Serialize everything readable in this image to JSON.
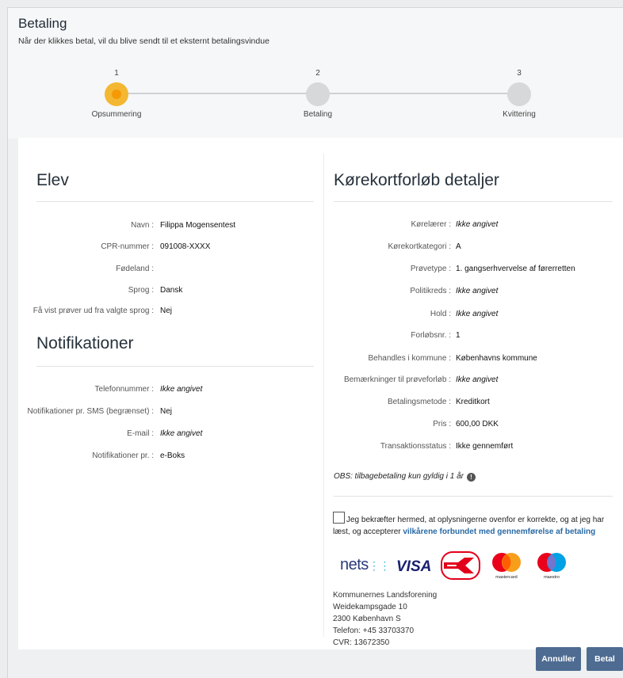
{
  "dialog": {
    "title": "Betaling",
    "subtitle": "Når der klikkes betal, vil du blive sendt til et eksternt betalingsvindue"
  },
  "steps": [
    {
      "number": "1",
      "label": "Opsummering",
      "active": true
    },
    {
      "number": "2",
      "label": "Betaling",
      "active": false
    },
    {
      "number": "3",
      "label": "Kvittering",
      "active": false
    }
  ],
  "elev": {
    "heading": "Elev",
    "fields": [
      {
        "label": "Navn :",
        "value": "Filippa Mogensentest"
      },
      {
        "label": "CPR-nummer :",
        "value": "091008-XXXX"
      },
      {
        "label": "Fødeland :",
        "value": ""
      },
      {
        "label": "Sprog :",
        "value": "Dansk"
      },
      {
        "label": "Få vist prøver ud fra valgte sprog :",
        "value": "Nej"
      }
    ]
  },
  "notifikationer": {
    "heading": "Notifikationer",
    "fields": [
      {
        "label": "Telefonnummer :",
        "value": "Ikke angivet"
      },
      {
        "label": "Notifikationer pr. SMS (begrænset) :",
        "value": "Nej"
      },
      {
        "label": "E-mail :",
        "value": "Ikke angivet"
      },
      {
        "label": "Notifikationer pr. :",
        "value": "e-Boks"
      }
    ]
  },
  "detaljer": {
    "heading": "Kørekortforløb detaljer",
    "fields": [
      {
        "label": "Kørelærer :",
        "value": "Ikke angivet"
      },
      {
        "label": "Kørekortkategori :",
        "value": "A"
      },
      {
        "label": "Prøvetype :",
        "value": "1. gangserhvervelse af førerretten"
      },
      {
        "label": "Politikreds :",
        "value": "Ikke angivet"
      },
      {
        "label": "Hold :",
        "value": "Ikke angivet"
      },
      {
        "label": "Forløbsnr. :",
        "value": "1"
      },
      {
        "label": "Behandles i kommune :",
        "value": "Københavns kommune"
      },
      {
        "label": "Bemærkninger til prøveforløb :",
        "value": "Ikke angivet"
      },
      {
        "label": "Betalingsmetode :",
        "value": "Kreditkort"
      },
      {
        "label": "Pris :",
        "value": "600,00 DKK"
      },
      {
        "label": "Transaktionsstatus :",
        "value": "Ikke gennemført"
      }
    ]
  },
  "obs_note": "OBS: tilbagebetaling kun gyldig i 1 år",
  "confirm": {
    "text": "Jeg bekræfter hermed, at oplysningerne ovenfor er korrekte, og at jeg har læst, og accepterer ",
    "link": "vilkårene forbundet med gennemførelse af betaling",
    "checked": false
  },
  "payment_logos": {
    "nets": "nets",
    "visa": "VISA",
    "mastercard": "mastercard",
    "maestro": "maestro"
  },
  "address": [
    "Kommunernes Landsforening",
    "Weidekampsgade 10",
    "2300 København S",
    "Telefon: +45 33703370",
    "CVR: 13672350"
  ],
  "buttons": {
    "cancel": "Annuller",
    "pay": "Betal"
  },
  "colors": {
    "active_step": "#f4b731",
    "inactive_step": "#d7d8d9",
    "button": "#4e6b91",
    "link": "#2a6aa5"
  }
}
